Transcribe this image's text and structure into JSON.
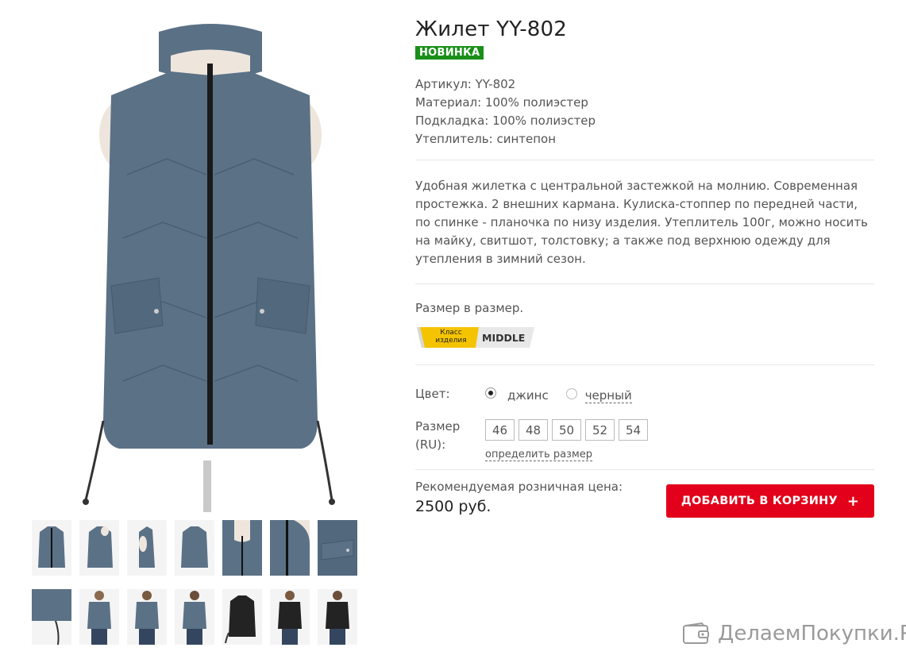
{
  "product": {
    "title": "Жилет YY-802",
    "badge": "НОВИНКА",
    "specs": [
      "Артикул: YY-802",
      "Материал: 100% полиэстер",
      "Подкладка: 100% полиэстер",
      "Утеплитель: синтепон"
    ],
    "description": "Удобная жилетка с центральной застежкой на молнию. Современная простежка. 2 внешних кармана. Кулиска-стоппер по передней части, по спинке - планочка по низу изделия. Утеплитель 100г, можно носить на майку, свитшот, толстовку; а также под верхнюю одежду для утепления в зимний сезон.",
    "size_note": "Размер в размер.",
    "class_badge": {
      "label_line1": "Класс",
      "label_line2": "изделия",
      "value": "MIDDLE"
    }
  },
  "options": {
    "color_label": "Цвет:",
    "colors": [
      {
        "name": "джинс",
        "selected": true
      },
      {
        "name": "черный",
        "selected": false
      }
    ],
    "size_label_line1": "Размер",
    "size_label_line2": "(RU):",
    "sizes": [
      "46",
      "48",
      "50",
      "52",
      "54"
    ],
    "size_link": "определить размер"
  },
  "price": {
    "label": "Рекомендуемая розничная цена:",
    "value": "2500 руб.",
    "cart_button": "ДОБАВИТЬ В КОРЗИНУ",
    "cart_button_icon": "+"
  },
  "colors": {
    "vest_blue": "#5a7085",
    "vest_black": "#232323",
    "accent_red": "#e2001a",
    "badge_green": "#1a8f1a",
    "class_yellow": "#f5c400"
  },
  "watermark": "ДелаемПокупки.Ру"
}
